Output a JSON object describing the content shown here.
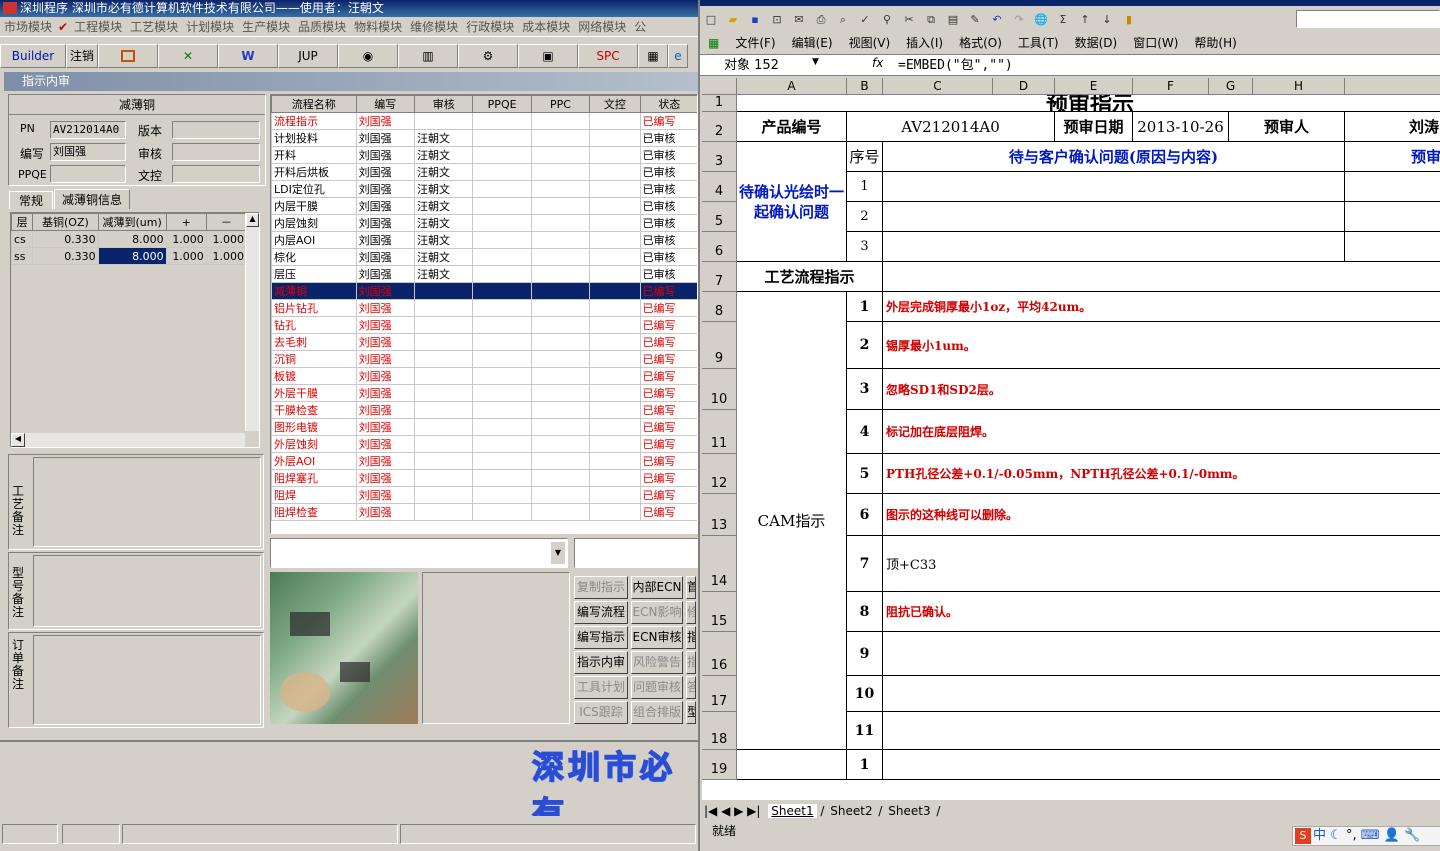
{
  "left_app": {
    "title": "深圳程序   深圳市必有德计算机软件技术有限公司——使用者：汪朝文",
    "menu": [
      "市场模块",
      "工程模块",
      "工艺模块",
      "计划模块",
      "生产模块",
      "品质模块",
      "物料模块",
      "维修模块",
      "行政模块",
      "成本模块",
      "网络模块",
      "公"
    ],
    "toolbar": [
      "Builder",
      "注销",
      "",
      "",
      "",
      "JUP",
      "",
      "",
      "",
      "",
      "SPC",
      "",
      ""
    ],
    "subtitle": "指示内审",
    "panel_title": "减薄铜",
    "labels": {
      "pn": "PN",
      "version": "版本",
      "writer": "编写",
      "audit": "审核",
      "ppqe": "PPQE",
      "docctrl": "文控"
    },
    "values": {
      "pn": "AV212014A0",
      "writer": "刘国强"
    },
    "tabs": [
      "常规",
      "减薄铜信息"
    ],
    "copper_table": {
      "headers": [
        "层",
        "基铜(OZ)",
        "减薄到(um)",
        "+",
        "－"
      ],
      "rows": [
        [
          "cs",
          "0.330",
          "8.000",
          "1.000",
          "1.000"
        ],
        [
          "ss",
          "0.330",
          "8.000",
          "1.000",
          "1.000"
        ]
      ]
    },
    "side_labels": [
      "工艺备注",
      "型号备注",
      "订单备注"
    ],
    "flow_table": {
      "headers": [
        "流程名称",
        "编写",
        "审核",
        "PPQE",
        "PPC",
        "文控",
        "状态"
      ],
      "rows": [
        [
          "流程指示",
          "刘国强",
          "",
          "",
          "",
          "",
          "已编写",
          "r"
        ],
        [
          "计划投料",
          "刘国强",
          "汪朝文",
          "",
          "",
          "",
          "已审核",
          ""
        ],
        [
          "开料",
          "刘国强",
          "汪朝文",
          "",
          "",
          "",
          "已审核",
          ""
        ],
        [
          "开料后烘板",
          "刘国强",
          "汪朝文",
          "",
          "",
          "",
          "已审核",
          ""
        ],
        [
          "LDI定位孔",
          "刘国强",
          "汪朝文",
          "",
          "",
          "",
          "已审核",
          ""
        ],
        [
          "内层干膜",
          "刘国强",
          "汪朝文",
          "",
          "",
          "",
          "已审核",
          ""
        ],
        [
          "内层蚀刻",
          "刘国强",
          "汪朝文",
          "",
          "",
          "",
          "已审核",
          ""
        ],
        [
          "内层AOI",
          "刘国强",
          "汪朝文",
          "",
          "",
          "",
          "已审核",
          ""
        ],
        [
          "棕化",
          "刘国强",
          "汪朝文",
          "",
          "",
          "",
          "已审核",
          ""
        ],
        [
          "层压",
          "刘国强",
          "汪朝文",
          "",
          "",
          "",
          "已审核",
          ""
        ],
        [
          "减薄铜",
          "刘国强",
          "",
          "",
          "",
          "",
          "已编写",
          "s"
        ],
        [
          "铝片钻孔",
          "刘国强",
          "",
          "",
          "",
          "",
          "已编写",
          "r"
        ],
        [
          "钻孔",
          "刘国强",
          "",
          "",
          "",
          "",
          "已编写",
          "r"
        ],
        [
          "去毛刺",
          "刘国强",
          "",
          "",
          "",
          "",
          "已编写",
          "r"
        ],
        [
          "沉铜",
          "刘国强",
          "",
          "",
          "",
          "",
          "已编写",
          "r"
        ],
        [
          "板镀",
          "刘国强",
          "",
          "",
          "",
          "",
          "已编写",
          "r"
        ],
        [
          "外层干膜",
          "刘国强",
          "",
          "",
          "",
          "",
          "已编写",
          "r"
        ],
        [
          "干膜检查",
          "刘国强",
          "",
          "",
          "",
          "",
          "已编写",
          "r"
        ],
        [
          "图形电镀",
          "刘国强",
          "",
          "",
          "",
          "",
          "已编写",
          "r"
        ],
        [
          "外层蚀刻",
          "刘国强",
          "",
          "",
          "",
          "",
          "已编写",
          "r"
        ],
        [
          "外层AOI",
          "刘国强",
          "",
          "",
          "",
          "",
          "已编写",
          "r"
        ],
        [
          "阻焊塞孔",
          "刘国强",
          "",
          "",
          "",
          "",
          "已编写",
          "r"
        ],
        [
          "阻焊",
          "刘国强",
          "",
          "",
          "",
          "",
          "已编写",
          "r"
        ],
        [
          "阻焊检查",
          "刘国强",
          "",
          "",
          "",
          "",
          "已编写",
          "r"
        ]
      ]
    },
    "buttons": [
      [
        "复制指示",
        "内部ECN",
        "首"
      ],
      [
        "编写流程",
        "ECN影响",
        "修"
      ],
      [
        "编写指示",
        "ECN审核",
        "指"
      ],
      [
        "指示内审",
        "风险警告",
        "指"
      ],
      [
        "工具计划",
        "问题审核",
        "答"
      ],
      [
        "ICS跟踪",
        "组合排版",
        "型"
      ]
    ],
    "buttons_disabled": [
      [
        true,
        false,
        false
      ],
      [
        false,
        true,
        true
      ],
      [
        false,
        false,
        false
      ],
      [
        false,
        true,
        true
      ],
      [
        true,
        true,
        true
      ],
      [
        true,
        true,
        false
      ]
    ],
    "banner": "深圳市必有"
  },
  "excel": {
    "menu": [
      "文件(F)",
      "编辑(E)",
      "视图(V)",
      "插入(I)",
      "格式(O)",
      "工具(T)",
      "数据(D)",
      "窗口(W)",
      "帮助(H)"
    ],
    "namebox": "对象 152",
    "formula": "=EMBED(\"包\",\"\")",
    "columns": [
      "A",
      "B",
      "C",
      "D",
      "E",
      "F",
      "G",
      "H"
    ],
    "rows": [
      "1",
      "2",
      "3",
      "4",
      "5",
      "6",
      "7",
      "8",
      "9",
      "10",
      "11",
      "12",
      "13",
      "14",
      "15",
      "16",
      "17",
      "18",
      "19"
    ],
    "title": "预审指示",
    "product_label": "产品编号",
    "product_no": "AV212014A0",
    "date_label": "预审日期",
    "date": "2013-10-26",
    "reviewer_label": "预审人",
    "reviewer": "刘涛",
    "seq_label": "序号",
    "question_header": "待与客户确认问题(原因与内容)",
    "pre_label": "预审",
    "confirm_label": "待确认光绘时一起确认问题",
    "q_nums": [
      "1",
      "2",
      "3"
    ],
    "flow_label": "工艺流程指示",
    "cam_label": "CAM指示",
    "cam_nums": [
      "1",
      "2",
      "3",
      "4",
      "5",
      "6",
      "7",
      "8",
      "9",
      "10",
      "11"
    ],
    "cam_items": [
      "外层完成铜厚最小1oz，平均42um。",
      "锡厚最小1um。",
      "忽略SD1和SD2层。",
      "标记加在底层阻焊。",
      "PTH孔径公差+0.1/-0.05mm，NPTH孔径公差+0.1/-0mm。",
      "图示的这种线可以删除。",
      "顶+C33",
      "阻抗已确认。",
      "",
      "",
      ""
    ],
    "last_num": "1",
    "sheets": [
      "Sheet1",
      "Sheet2",
      "Sheet3"
    ],
    "status": "就绪"
  },
  "taskbar": {
    "ime": "中"
  }
}
